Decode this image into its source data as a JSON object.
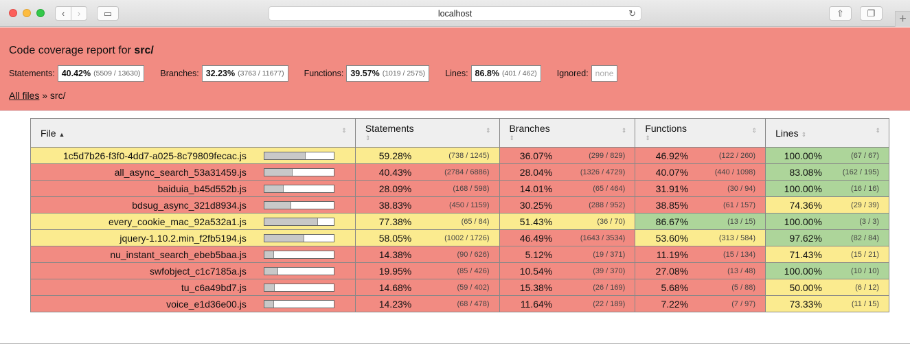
{
  "browser": {
    "url": "localhost",
    "back_glyph": "‹",
    "forward_glyph": "›",
    "reload_glyph": "↻",
    "share_glyph": "⇧",
    "tabs_glyph": "❐",
    "sidebar_glyph": "▭",
    "new_tab_glyph": "+"
  },
  "header": {
    "title_prefix": "Code coverage report for ",
    "title_path": "src/",
    "summary": [
      {
        "label": "Statements:",
        "pct": "40.42%",
        "frac": "(5509 / 13630)"
      },
      {
        "label": "Branches:",
        "pct": "32.23%",
        "frac": "(3763 / 11677)"
      },
      {
        "label": "Functions:",
        "pct": "39.57%",
        "frac": "(1019 / 2575)"
      },
      {
        "label": "Lines:",
        "pct": "86.8%",
        "frac": "(401 / 462)"
      }
    ],
    "ignored_label": "Ignored:",
    "ignored_value": "none",
    "breadcrumb_link": "All files",
    "breadcrumb_rest": " » src/"
  },
  "table": {
    "headers": {
      "file": "File",
      "file_sort": "▲",
      "statements": "Statements",
      "branches": "Branches",
      "functions": "Functions",
      "lines": "Lines",
      "sort_icon": "⇕"
    },
    "rows": [
      {
        "file": "1c5d7b26-f3f0-4dd7-a025-8c79809fecac.js",
        "row_level": "med",
        "bar": 0.5928,
        "st": "59.28%",
        "st_abs": "(738 / 1245)",
        "st_level": "med",
        "br": "36.07%",
        "br_abs": "(299 / 829)",
        "br_level": "low",
        "fn": "46.92%",
        "fn_abs": "(122 / 260)",
        "fn_level": "low",
        "ln": "100.00%",
        "ln_abs": "(67 / 67)",
        "ln_level": "high"
      },
      {
        "file": "all_async_search_53a31459.js",
        "row_level": "low",
        "bar": 0.4043,
        "st": "40.43%",
        "st_abs": "(2784 / 6886)",
        "st_level": "low",
        "br": "28.04%",
        "br_abs": "(1326 / 4729)",
        "br_level": "low",
        "fn": "40.07%",
        "fn_abs": "(440 / 1098)",
        "fn_level": "low",
        "ln": "83.08%",
        "ln_abs": "(162 / 195)",
        "ln_level": "high"
      },
      {
        "file": "baiduia_b45d552b.js",
        "row_level": "low",
        "bar": 0.2809,
        "st": "28.09%",
        "st_abs": "(168 / 598)",
        "st_level": "low",
        "br": "14.01%",
        "br_abs": "(65 / 464)",
        "br_level": "low",
        "fn": "31.91%",
        "fn_abs": "(30 / 94)",
        "fn_level": "low",
        "ln": "100.00%",
        "ln_abs": "(16 / 16)",
        "ln_level": "high"
      },
      {
        "file": "bdsug_async_321d8934.js",
        "row_level": "low",
        "bar": 0.3883,
        "st": "38.83%",
        "st_abs": "(450 / 1159)",
        "st_level": "low",
        "br": "30.25%",
        "br_abs": "(288 / 952)",
        "br_level": "low",
        "fn": "38.85%",
        "fn_abs": "(61 / 157)",
        "fn_level": "low",
        "ln": "74.36%",
        "ln_abs": "(29 / 39)",
        "ln_level": "med"
      },
      {
        "file": "every_cookie_mac_92a532a1.js",
        "row_level": "med",
        "bar": 0.7738,
        "st": "77.38%",
        "st_abs": "(65 / 84)",
        "st_level": "med",
        "br": "51.43%",
        "br_abs": "(36 / 70)",
        "br_level": "med",
        "fn": "86.67%",
        "fn_abs": "(13 / 15)",
        "fn_level": "high",
        "ln": "100.00%",
        "ln_abs": "(3 / 3)",
        "ln_level": "high"
      },
      {
        "file": "jquery-1.10.2.min_f2fb5194.js",
        "row_level": "med",
        "bar": 0.5805,
        "st": "58.05%",
        "st_abs": "(1002 / 1726)",
        "st_level": "med",
        "br": "46.49%",
        "br_abs": "(1643 / 3534)",
        "br_level": "low",
        "fn": "53.60%",
        "fn_abs": "(313 / 584)",
        "fn_level": "med",
        "ln": "97.62%",
        "ln_abs": "(82 / 84)",
        "ln_level": "high"
      },
      {
        "file": "nu_instant_search_ebeb5baa.js",
        "row_level": "low",
        "bar": 0.1438,
        "st": "14.38%",
        "st_abs": "(90 / 626)",
        "st_level": "low",
        "br": "5.12%",
        "br_abs": "(19 / 371)",
        "br_level": "low",
        "fn": "11.19%",
        "fn_abs": "(15 / 134)",
        "fn_level": "low",
        "ln": "71.43%",
        "ln_abs": "(15 / 21)",
        "ln_level": "med"
      },
      {
        "file": "swfobject_c1c7185a.js",
        "row_level": "low",
        "bar": 0.1995,
        "st": "19.95%",
        "st_abs": "(85 / 426)",
        "st_level": "low",
        "br": "10.54%",
        "br_abs": "(39 / 370)",
        "br_level": "low",
        "fn": "27.08%",
        "fn_abs": "(13 / 48)",
        "fn_level": "low",
        "ln": "100.00%",
        "ln_abs": "(10 / 10)",
        "ln_level": "high"
      },
      {
        "file": "tu_c6a49bd7.js",
        "row_level": "low",
        "bar": 0.1468,
        "st": "14.68%",
        "st_abs": "(59 / 402)",
        "st_level": "low",
        "br": "15.38%",
        "br_abs": "(26 / 169)",
        "br_level": "low",
        "fn": "5.68%",
        "fn_abs": "(5 / 88)",
        "fn_level": "low",
        "ln": "50.00%",
        "ln_abs": "(6 / 12)",
        "ln_level": "med"
      },
      {
        "file": "voice_e1d36e00.js",
        "row_level": "low",
        "bar": 0.1423,
        "st": "14.23%",
        "st_abs": "(68 / 478)",
        "st_level": "low",
        "br": "11.64%",
        "br_abs": "(22 / 189)",
        "br_level": "low",
        "fn": "7.22%",
        "fn_abs": "(7 / 97)",
        "fn_level": "low",
        "ln": "73.33%",
        "ln_abs": "(11 / 15)",
        "ln_level": "med"
      }
    ]
  },
  "colors": {
    "low": "#f28b82",
    "medium": "#fbeb8f",
    "high": "#add59a"
  }
}
